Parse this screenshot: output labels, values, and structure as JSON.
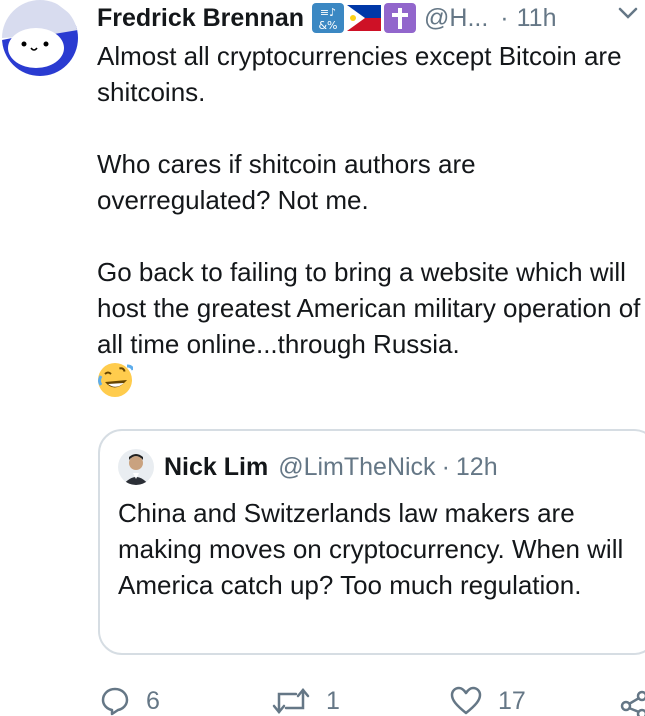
{
  "tweet": {
    "display_name": "Fredrick Brennan",
    "handle": "@H...",
    "time_separator": "·",
    "time": "11h",
    "avatar_icon": "bunny-face-avatar",
    "name_emoji_icons": [
      "input-symbols-icon",
      "philippines-flag-icon",
      "latin-cross-icon"
    ],
    "paragraphs": [
      "Almost all cryptocurrencies except Bitcoin are shitcoins.",
      "Who cares if shitcoin authors are overregulated? Not me.",
      "Go back to failing to bring a website which will host the greatest American military operation of all time online...through Russia."
    ],
    "trailing_emoji": "rolling-on-floor-laughing-icon"
  },
  "quoted_tweet": {
    "display_name": "Nick Lim",
    "handle": "@LimTheNick",
    "time_separator": "·",
    "time": "12h",
    "text": "China and Switzerlands law makers are making moves on cryptocurrency. When will America catch up? Too much regulation."
  },
  "actions": {
    "reply_count": "6",
    "retweet_count": "1",
    "like_count": "17"
  },
  "colors": {
    "text": "#14171a",
    "secondary": "#657786",
    "border": "#d6dde3"
  }
}
